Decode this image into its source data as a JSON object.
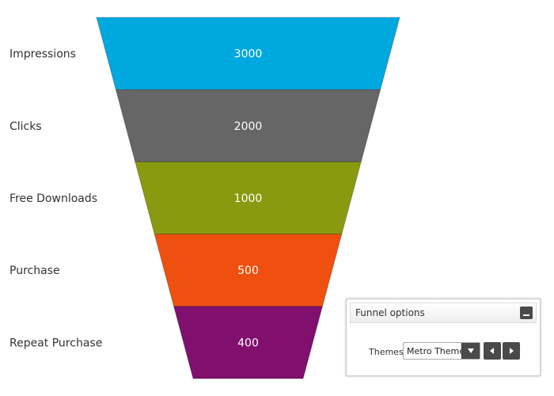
{
  "chart_data": {
    "type": "funnel",
    "categories": [
      "Impressions",
      "Clicks",
      "Free Downloads",
      "Purchase",
      "Repeat Purchase"
    ],
    "values": [
      3000,
      2000,
      1000,
      500,
      400
    ],
    "colors": [
      "#00a8e0",
      "#666666",
      "#8a9a10",
      "#f0500f",
      "#800f6e"
    ],
    "title": "",
    "xlabel": "",
    "ylabel": ""
  },
  "options_panel": {
    "title": "Funnel options",
    "themes_label": "Themes",
    "selected_theme": "Metro Theme",
    "icons": {
      "minimize": "minimize-icon",
      "dropdown": "chevron-down-icon",
      "prev": "chevron-left-icon",
      "next": "chevron-right-icon"
    }
  }
}
